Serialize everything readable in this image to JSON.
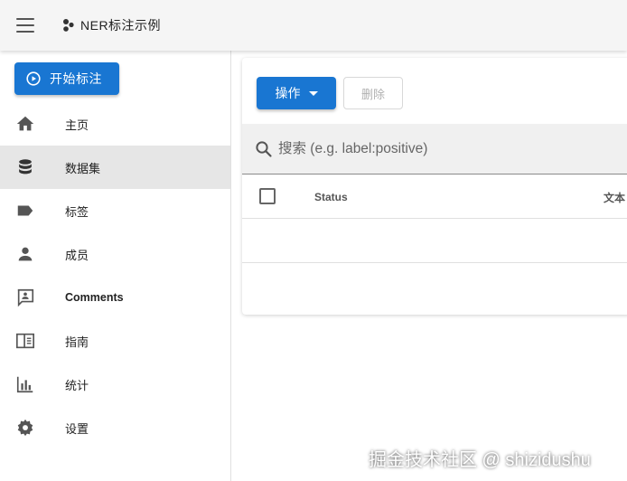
{
  "appbar": {
    "title": "NER标注示例",
    "menu_icon": "hamburger-menu-icon",
    "logo_icon": "bubbles-logo-icon"
  },
  "sidebar": {
    "start_button": {
      "label": "开始标注",
      "icon": "play-circle-icon"
    },
    "items": [
      {
        "label": "主页",
        "icon": "home-icon",
        "active": false
      },
      {
        "label": "数据集",
        "icon": "database-icon",
        "active": true
      },
      {
        "label": "标签",
        "icon": "label-icon",
        "active": false
      },
      {
        "label": "成员",
        "icon": "person-icon",
        "active": false
      },
      {
        "label": "Comments",
        "icon": "comment-account-icon",
        "active": false
      },
      {
        "label": "指南",
        "icon": "book-open-icon",
        "active": false
      },
      {
        "label": "统计",
        "icon": "chart-bar-icon",
        "active": false
      },
      {
        "label": "设置",
        "icon": "gear-icon",
        "active": false
      }
    ]
  },
  "toolbar": {
    "action_label": "操作",
    "delete_label": "删除"
  },
  "search": {
    "placeholder": "搜索 (e.g. label:positive)",
    "value": ""
  },
  "table": {
    "columns": [
      "Status",
      "文本"
    ],
    "rows": []
  },
  "watermark": "掘金技术社区 @ shizidushu",
  "colors": {
    "primary": "#1976d2",
    "appbar_bg": "#f5f5f5",
    "active_item_bg": "#e6e6e6"
  }
}
